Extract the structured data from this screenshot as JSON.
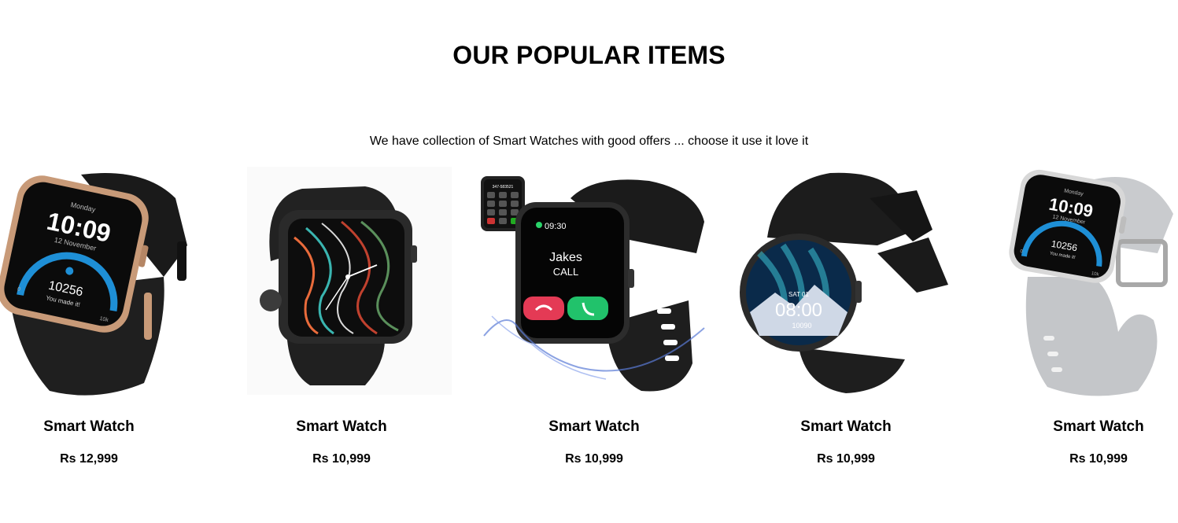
{
  "section": {
    "title": "OUR POPULAR ITEMS",
    "subtitle": "We have collection of Smart Watches with good offers ... choose it use it love it"
  },
  "products": [
    {
      "name": "Smart Watch",
      "price": "Rs 12,999",
      "icon": "watch-rose-gold-icon",
      "screen": {
        "day": "Monday",
        "time": "10:09",
        "date": "12 November",
        "steps": "10256",
        "message": "You made it!",
        "goal": "10k",
        "zero": "0"
      }
    },
    {
      "name": "Smart Watch",
      "price": "Rs 10,999",
      "icon": "watch-black-analog-icon"
    },
    {
      "name": "Smart Watch",
      "price": "Rs 10,999",
      "icon": "watch-call-splash-icon",
      "screen": {
        "time": "09:30",
        "caller": "Jakes",
        "status": "CALL",
        "dial_number": "347-583521"
      }
    },
    {
      "name": "Smart Watch",
      "price": "Rs 10,999",
      "icon": "watch-round-aurora-icon",
      "screen": {
        "date": "SAT 01",
        "time": "08:00",
        "steps": "10090"
      }
    },
    {
      "name": "Smart Watch",
      "price": "Rs 10,999",
      "icon": "watch-silver-icon",
      "screen": {
        "day": "Monday",
        "time": "10:09",
        "date": "12 November",
        "steps": "10256",
        "message": "You made it!",
        "goal": "10k",
        "zero": "0"
      }
    }
  ]
}
